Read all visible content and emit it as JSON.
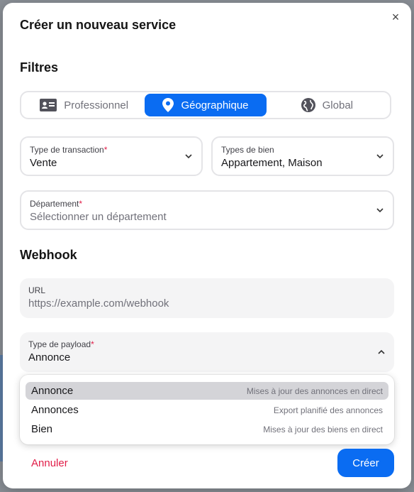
{
  "modal": {
    "title": "Créer un nouveau service",
    "close_icon": "×"
  },
  "filters": {
    "title": "Filtres",
    "tabs": [
      {
        "label": "Professionnel",
        "icon": "id-card-icon",
        "active": false
      },
      {
        "label": "Géographique",
        "icon": "map-pin-icon",
        "active": true
      },
      {
        "label": "Global",
        "icon": "globe-icon",
        "active": false
      }
    ],
    "transaction_type": {
      "label": "Type de transaction",
      "required_mark": "*",
      "value": "Vente"
    },
    "property_types": {
      "label": "Types de bien",
      "value": "Appartement, Maison"
    },
    "department": {
      "label": "Département",
      "required_mark": "*",
      "placeholder": "Sélectionner un département"
    }
  },
  "webhook": {
    "title": "Webhook",
    "url": {
      "label": "URL",
      "placeholder": "https://example.com/webhook"
    },
    "payload_type": {
      "label": "Type de payload",
      "required_mark": "*",
      "value": "Annonce"
    },
    "options": [
      {
        "label": "Annonce",
        "description": "Mises à jour des annonces en direct",
        "highlighted": true
      },
      {
        "label": "Annonces",
        "description": "Export planifié des annonces",
        "highlighted": false
      },
      {
        "label": "Bien",
        "description": "Mises à jour des biens en direct",
        "highlighted": false
      }
    ]
  },
  "footer": {
    "cancel_label": "Annuler",
    "create_label": "Créer"
  },
  "colors": {
    "accent": "#0a6cf2",
    "danger": "#e11d48",
    "highlight": "#d4d4d8"
  }
}
